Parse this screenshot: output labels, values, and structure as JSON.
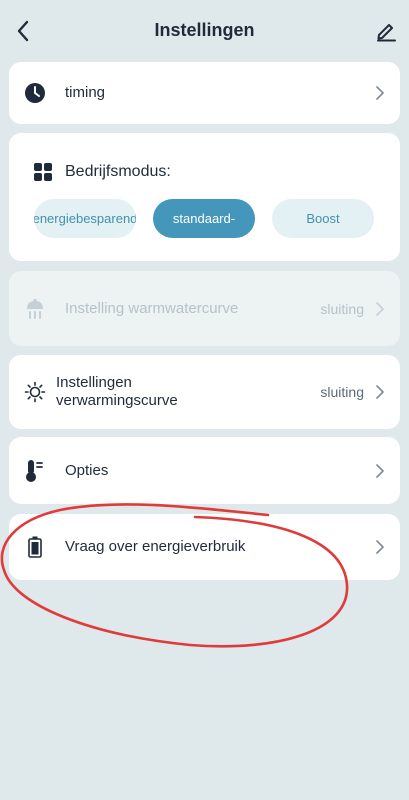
{
  "header": {
    "title": "Instellingen"
  },
  "timing": {
    "label": "timing"
  },
  "mode": {
    "title": "Bedrijfsmodus:",
    "options": [
      {
        "label": "energiebesparend",
        "active": false
      },
      {
        "label": "standaard-",
        "active": true
      },
      {
        "label": "Boost",
        "active": false
      }
    ]
  },
  "hot_water_curve": {
    "label": "Instelling warmwatercurve",
    "value": "sluiting"
  },
  "heating_curve": {
    "label_line1": "Instellingen",
    "label_line2": "verwarmingscurve",
    "value": "sluiting"
  },
  "options": {
    "label": "Opties"
  },
  "energy": {
    "label": "Vraag over energieverbruik"
  },
  "colors": {
    "background": "#dfe8ea",
    "accent": "#4497ba",
    "annotation": "#e03b3b"
  }
}
